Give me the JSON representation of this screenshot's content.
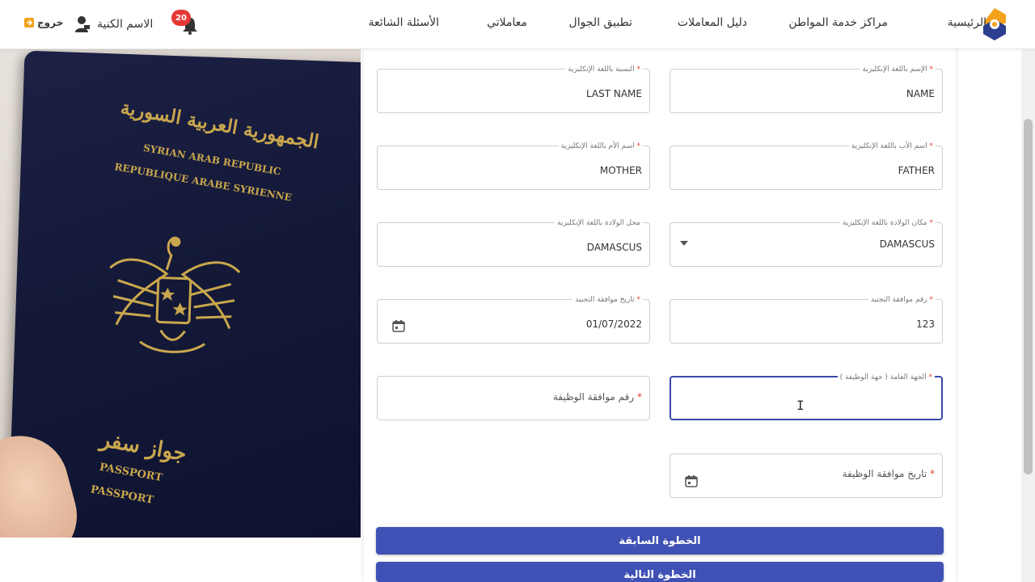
{
  "nav": {
    "home": "الرئيسية",
    "centers": "مراكز خدمة المواطن",
    "guide": "دليل المعاملات",
    "mobile_app": "تطبيق الجوال",
    "transactions": "معاملاتي",
    "faq": "الأسئلة الشائعة"
  },
  "user": {
    "name": "الاسم الكنية",
    "notification_count": "20",
    "logout": "خروج"
  },
  "passport": {
    "arabic_title": "الجمهورية العربية السورية",
    "english_line1": "SYRIAN ARAB REPUBLIC",
    "english_line2": "REPUBLIQUE ARABE SYRIENNE",
    "arabic_passport": "جواز سفر",
    "passport_1": "PASSPORT",
    "passport_2": "PASSPORT"
  },
  "form": {
    "name_en": {
      "label": "الإسم باللغة الإنكليزية",
      "value": "NAME"
    },
    "surname_en": {
      "label": "النسبة باللغة الإنكليزية",
      "value": "LAST NAME"
    },
    "father_en": {
      "label": "اسم الأب باللغة الإنكليزية",
      "value": "FATHER"
    },
    "mother_en": {
      "label": "اسم الأم باللغة الإنكليزية",
      "value": "MOTHER"
    },
    "birthplace_select": {
      "label": "مكان الولادة باللغة الإنكليزية",
      "value": "DAMASCUS"
    },
    "birthplace_text": {
      "label": "محل الولادة باللغة الإنكليزية",
      "value": "DAMASCUS"
    },
    "conscription_number": {
      "label": "رقم موافقة التجنيد",
      "value": "123"
    },
    "conscription_date": {
      "label": "تاريخ موافقة التجنيد",
      "value": "01/07/2022"
    },
    "employer": {
      "label": "الجهة العامة ( جهة الوظيفة )",
      "value": ""
    },
    "job_approval_number": {
      "placeholder": "رقم موافقة الوظيفة"
    },
    "job_approval_date": {
      "placeholder": "تاريخ موافقة الوظيفة"
    },
    "required_mark": "*"
  },
  "buttons": {
    "previous": "الخطوة السابقة",
    "next": "الخطوة التالية"
  },
  "colors": {
    "primary": "#3f51b5",
    "badge": "#e53935",
    "passport_gold": "#c9a74d",
    "passport_cover": "#141938"
  }
}
